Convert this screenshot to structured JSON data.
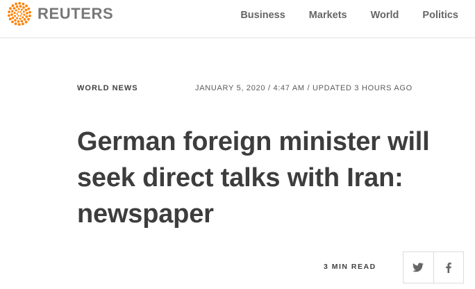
{
  "header": {
    "brand": "REUTERS",
    "brand_color": "#ff8000",
    "nav": [
      {
        "label": "Business"
      },
      {
        "label": "Markets"
      },
      {
        "label": "World"
      },
      {
        "label": "Politics"
      }
    ]
  },
  "article": {
    "section": "WORLD NEWS",
    "dateline": "JANUARY 5, 2020 / 4:47 AM / UPDATED 3 HOURS AGO",
    "headline": "German foreign minister will seek direct talks with Iran: newspaper",
    "read_time": "3 MIN READ"
  },
  "share": {
    "buttons": [
      {
        "icon": "twitter-icon"
      },
      {
        "icon": "facebook-icon"
      }
    ]
  }
}
